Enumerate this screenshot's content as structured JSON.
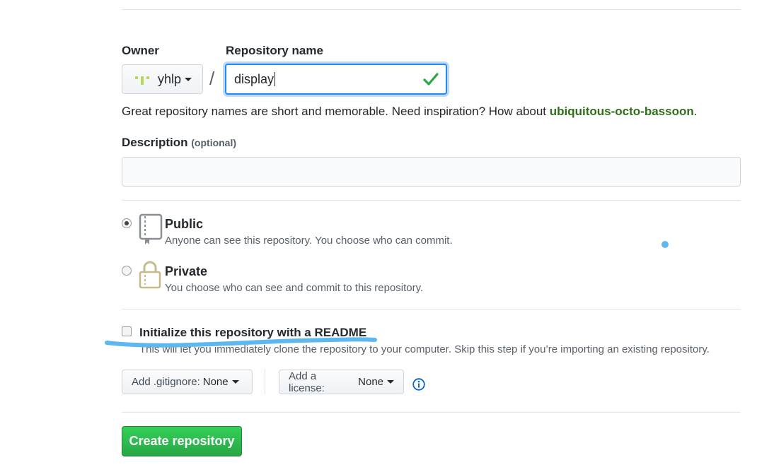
{
  "owner": {
    "label": "Owner",
    "value": "yhlp"
  },
  "repo_name": {
    "label": "Repository name",
    "value": "display"
  },
  "name_hint": {
    "text": "Great repository names are short and memorable. Need inspiration? How about ",
    "suggestion": "ubiquitous-octo-bassoon",
    "suffix": "."
  },
  "description": {
    "label": "Description",
    "optional": "(optional)",
    "value": ""
  },
  "visibility": {
    "selected": "public",
    "public": {
      "title": "Public",
      "desc": "Anyone can see this repository. You choose who can commit."
    },
    "private": {
      "title": "Private",
      "desc": "You choose who can see and commit to this repository."
    }
  },
  "readme": {
    "label": "Initialize this repository with a README",
    "desc": "This will let you immediately clone the repository to your computer. Skip this step if you’re importing an existing repository.",
    "checked": false
  },
  "gitignore": {
    "key": "Add .gitignore:",
    "value": "None"
  },
  "license": {
    "key": "Add a license:",
    "value": "None"
  },
  "create_button": "Create repository",
  "colors": {
    "accent_green": "#2ea44f",
    "focus_blue": "#2188ff",
    "suggestion_green": "#2f6f1b",
    "highlight_stroke": "#5fb7ef"
  },
  "icons": {
    "public": "repo-icon",
    "private": "lock-icon",
    "valid": "check-icon",
    "info": "info-icon"
  }
}
